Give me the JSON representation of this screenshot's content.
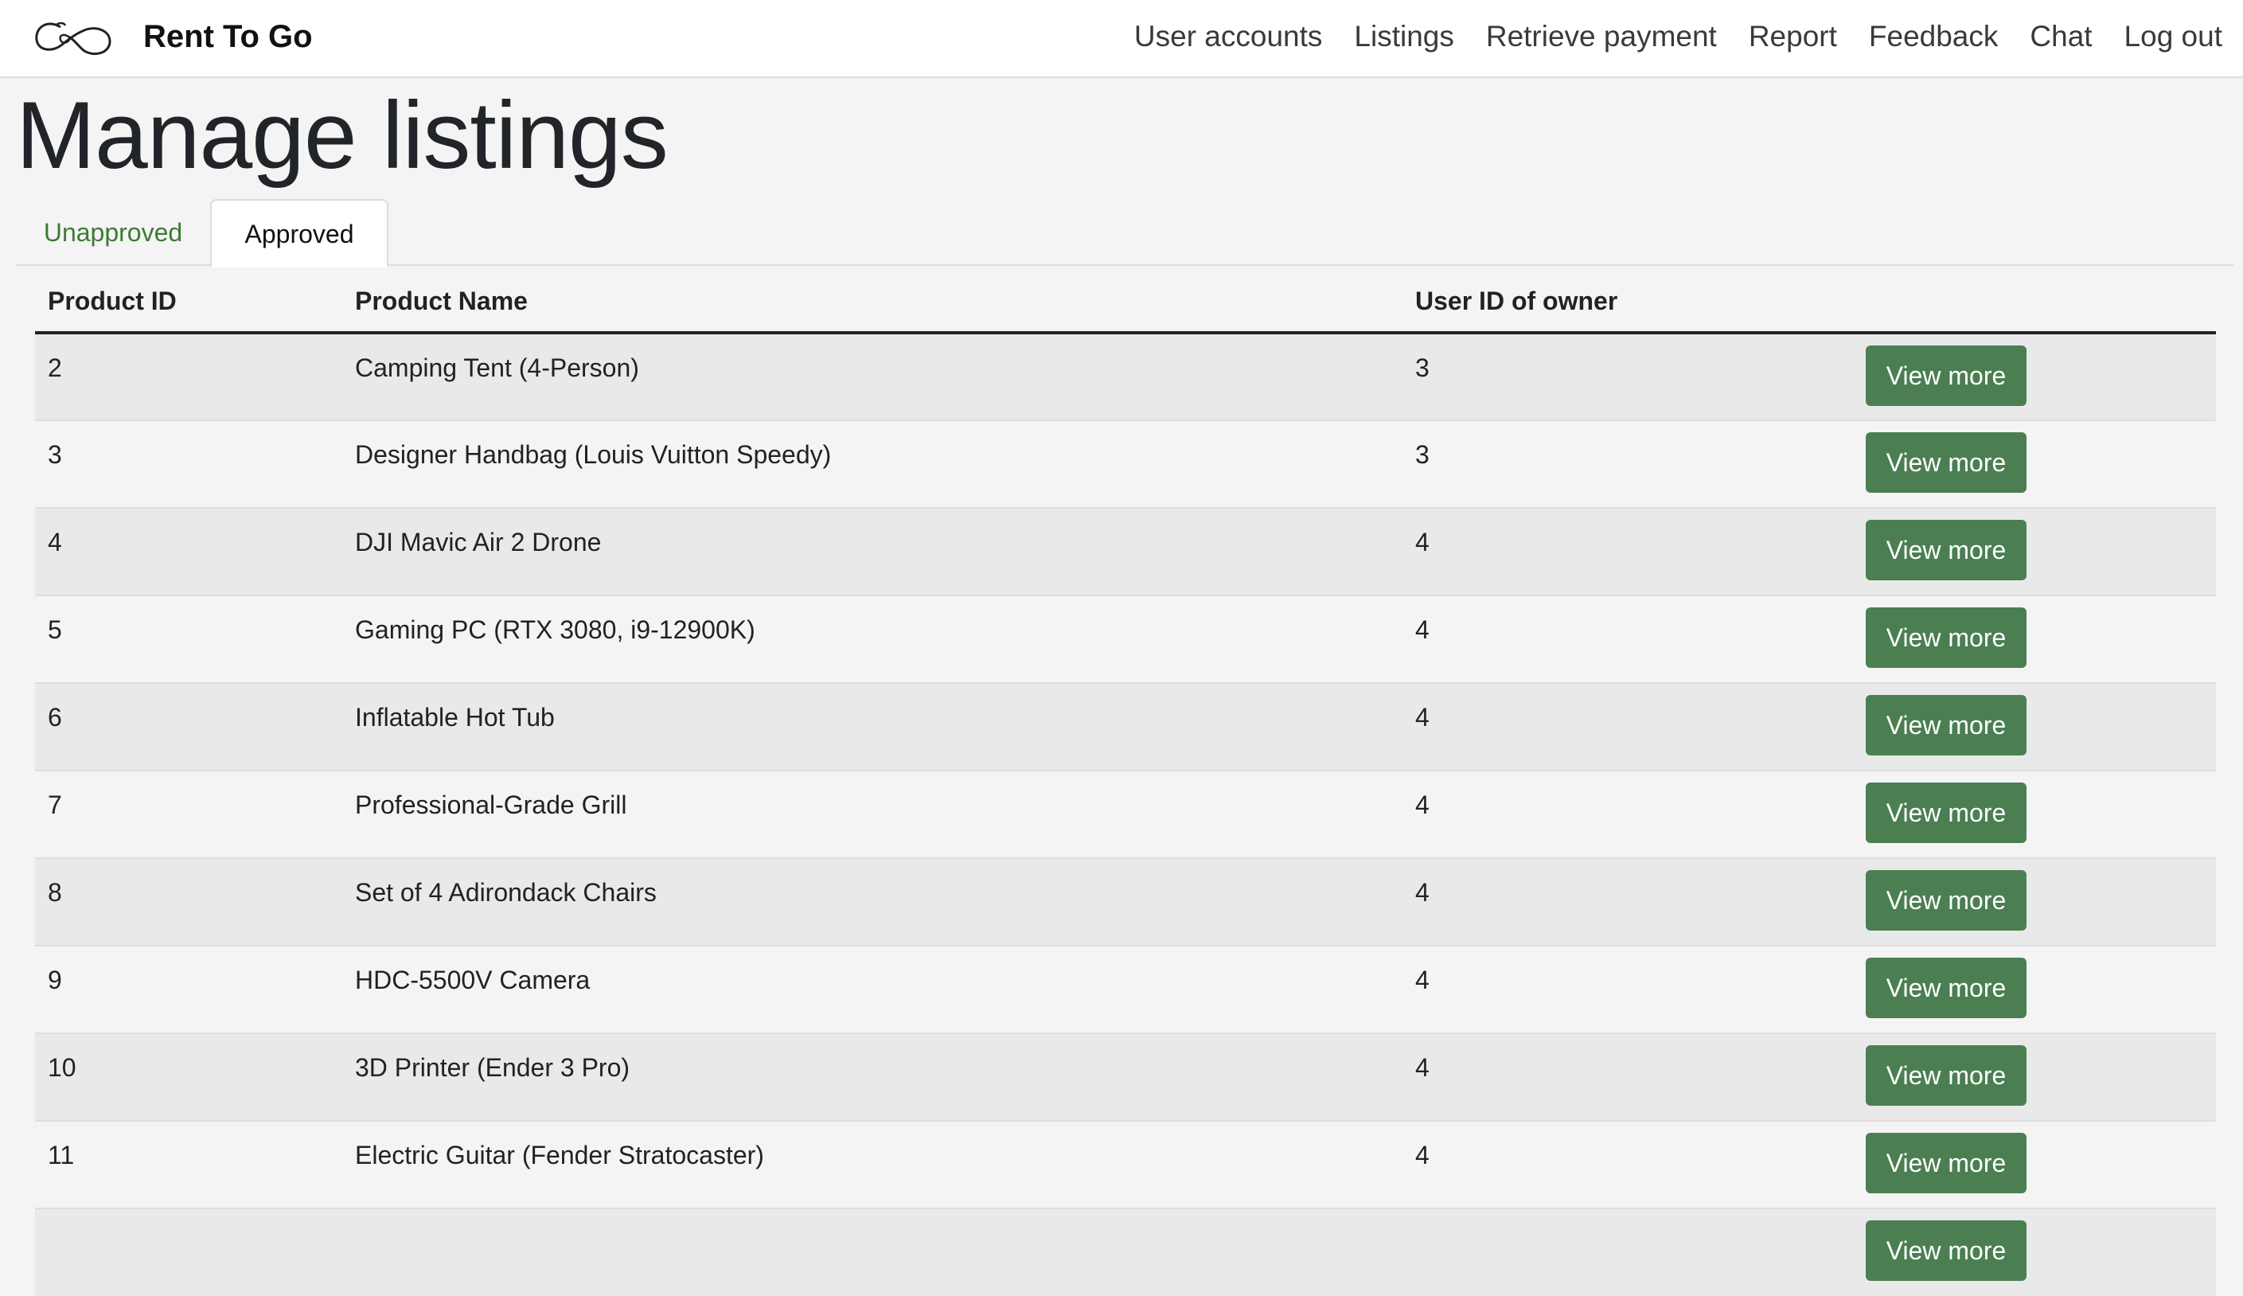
{
  "header": {
    "brand": "Rent To Go",
    "nav": [
      "User accounts",
      "Listings",
      "Retrieve payment",
      "Report",
      "Feedback",
      "Chat",
      "Log out"
    ]
  },
  "page": {
    "title": "Manage listings"
  },
  "tabs": {
    "unapproved": "Unapproved",
    "approved": "Approved",
    "active": "Approved"
  },
  "table": {
    "columns": [
      "Product ID",
      "Product Name",
      "User ID of owner",
      ""
    ],
    "action_label": "View more",
    "rows": [
      {
        "id": "2",
        "name": "Camping Tent (4-Person)",
        "owner": "3"
      },
      {
        "id": "3",
        "name": "Designer Handbag (Louis Vuitton Speedy)",
        "owner": "3"
      },
      {
        "id": "4",
        "name": "DJI Mavic Air 2 Drone",
        "owner": "4"
      },
      {
        "id": "5",
        "name": "Gaming PC (RTX 3080, i9-12900K)",
        "owner": "4"
      },
      {
        "id": "6",
        "name": "Inflatable Hot Tub",
        "owner": "4"
      },
      {
        "id": "7",
        "name": "Professional-Grade Grill",
        "owner": "4"
      },
      {
        "id": "8",
        "name": "Set of 4 Adirondack Chairs",
        "owner": "4"
      },
      {
        "id": "9",
        "name": "HDC-5500V Camera",
        "owner": "4"
      },
      {
        "id": "10",
        "name": "3D Printer (Ender 3 Pro)",
        "owner": "4"
      },
      {
        "id": "11",
        "name": "Electric Guitar (Fender Stratocaster)",
        "owner": "4"
      },
      {
        "id": "",
        "name": "",
        "owner": ""
      }
    ]
  },
  "colors": {
    "accent_green": "#4b7f52",
    "tab_link_green": "#3d7a34",
    "row_stripe": "#e9e9e9",
    "background": "#f4f4f4"
  },
  "icons": {
    "logo": "infinity-loop-logo-icon"
  }
}
